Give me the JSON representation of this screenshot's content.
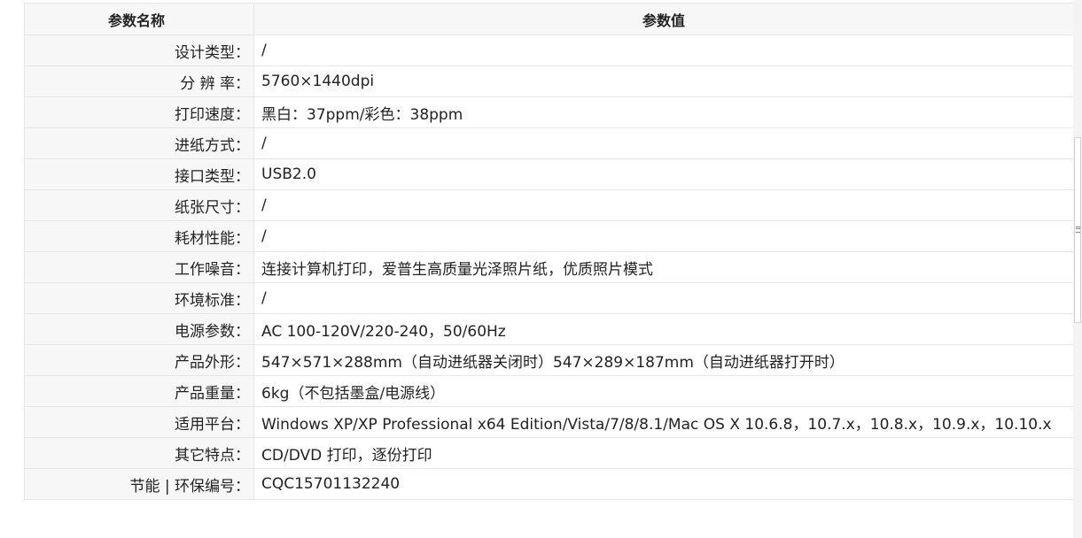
{
  "table": {
    "header": {
      "name": "参数名称",
      "value": "参数值"
    },
    "rows": [
      {
        "name": "设计类型：",
        "value": "/"
      },
      {
        "name": "分 辨 率：",
        "value": "5760×1440dpi"
      },
      {
        "name": "打印速度：",
        "value": "黑白：37ppm/彩色：38ppm"
      },
      {
        "name": "进纸方式：",
        "value": "/"
      },
      {
        "name": "接口类型：",
        "value": "USB2.0"
      },
      {
        "name": "纸张尺寸：",
        "value": "/"
      },
      {
        "name": "耗材性能：",
        "value": "/"
      },
      {
        "name": "工作噪音：",
        "value": "连接计算机打印，爱普生高质量光泽照片纸，优质照片模式"
      },
      {
        "name": "环境标准：",
        "value": "/"
      },
      {
        "name": "电源参数：",
        "value": "AC 100-120V/220-240，50/60Hz"
      },
      {
        "name": "产品外形：",
        "value": "547×571×288mm（自动进纸器关闭时）547×289×187mm（自动进纸器打开时）"
      },
      {
        "name": "产品重量：",
        "value": "6kg（不包括墨盒/电源线）"
      },
      {
        "name": "适用平台：",
        "value": "Windows XP/XP Professional x64 Edition/Vista/7/8/8.1/Mac OS X 10.6.8，10.7.x，10.8.x，10.9.x，10.10.x"
      },
      {
        "name": "其它特点：",
        "value": "CD/DVD 打印，逐份打印"
      },
      {
        "name": "节能 | 环保编号：",
        "value": "CQC15701132240"
      }
    ]
  },
  "colors": {
    "header_bg": "#f7f7f7",
    "border": "#e6e6e6",
    "text": "#222222"
  },
  "scrollbar": {
    "thumb_icon": "grip-icon"
  }
}
